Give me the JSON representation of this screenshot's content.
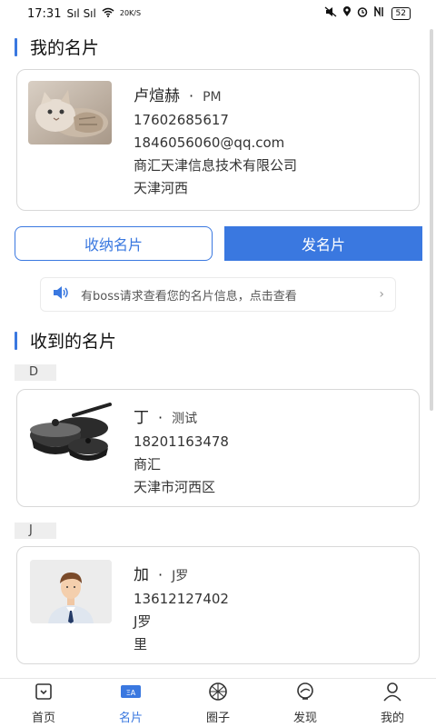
{
  "status_bar": {
    "time": "17:31",
    "signal": "Sıl Sıl",
    "speed": "20K/S",
    "battery": "52",
    "colors": {
      "accent": "#3a78e0"
    }
  },
  "my_card_section": {
    "title": "我的名片"
  },
  "my_card": {
    "name": "卢煊赫",
    "dot": "·",
    "role": "PM",
    "phone": "17602685617",
    "email": "1846056060@qq.com",
    "company": "商汇天津信息技术有限公司",
    "address": "天津河西"
  },
  "actions": {
    "collect_label": "收纳名片",
    "send_label": "发名片"
  },
  "notice": {
    "text": "有boss请求查看您的名片信息，点击查看",
    "chevron": "›"
  },
  "received_section": {
    "title": "收到的名片"
  },
  "groups": [
    {
      "letter": "D",
      "card": {
        "name": "丁",
        "dot": "·",
        "role": "测试",
        "phone": "18201163478",
        "company": "商汇",
        "address": "天津市河西区"
      }
    },
    {
      "letter": "J",
      "card": {
        "name": "加",
        "dot": "·",
        "role": "J罗",
        "phone": "13612127402",
        "company": "J罗",
        "address": "里"
      }
    }
  ],
  "tabs": [
    {
      "label": "首页",
      "icon": "home-icon"
    },
    {
      "label": "名片",
      "icon": "card-icon"
    },
    {
      "label": "圈子",
      "icon": "circle-icon"
    },
    {
      "label": "发现",
      "icon": "discover-icon"
    },
    {
      "label": "我的",
      "icon": "user-icon"
    }
  ]
}
